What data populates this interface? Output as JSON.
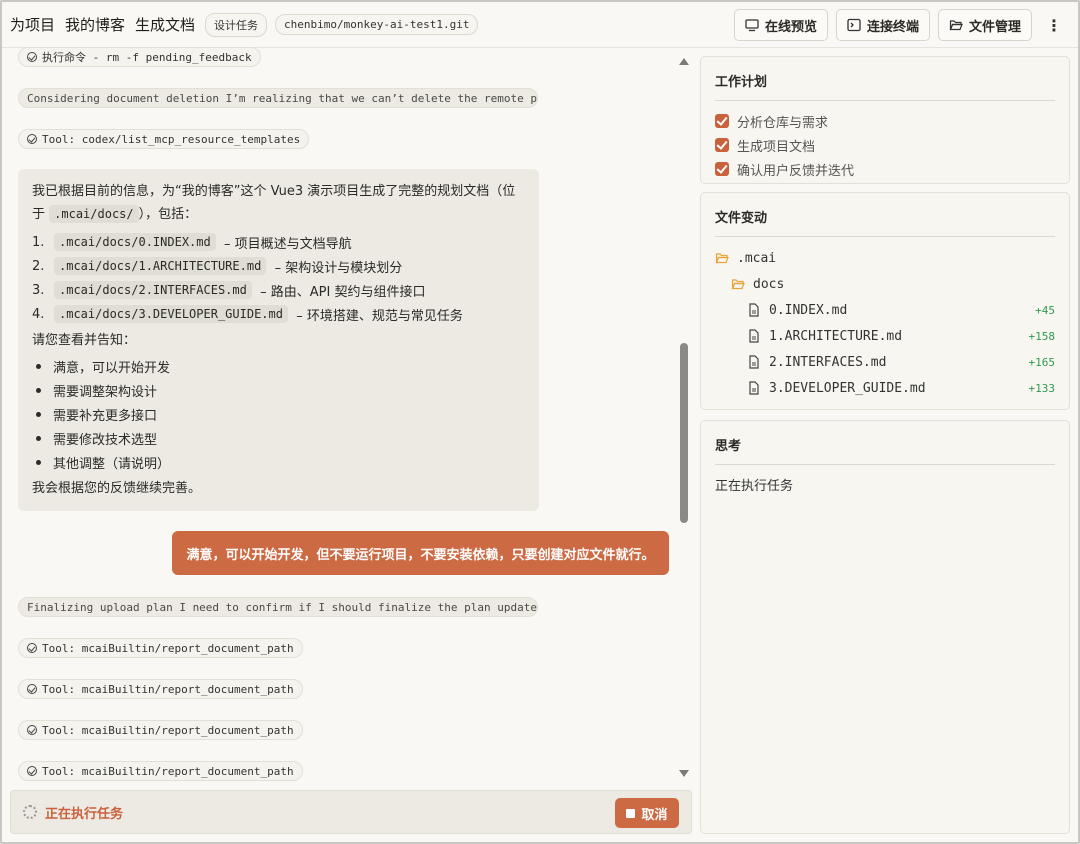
{
  "header": {
    "crumbs": [
      "为项目",
      "我的博客",
      "生成文档"
    ],
    "task_badge": "设计任务",
    "repo": "chenbimo/monkey-ai-test1.git",
    "buttons": {
      "preview": "在线预览",
      "terminal": "连接终端",
      "files": "文件管理"
    },
    "more": "⋮"
  },
  "chat": {
    "top_cmd": "执行命令 - rm -f pending_feedback",
    "reason1": "Considering document deletion I’m realizing that we can’t delete the remote path...",
    "tool_top": "Tool: codex/list_mcp_resource_templates",
    "assistant": {
      "intro_a": "我已根据目前的信息，为“我的博客”这个 Vue3 演示项目生成了完整的规划文档（位",
      "intro_b_pre": "于",
      "intro_b_code": ".mcai/docs/",
      "intro_b_post": "），包括：",
      "docs": [
        {
          "num": "1.",
          "code": ".mcai/docs/0.INDEX.md",
          "desc": "– 项目概述与文档导航"
        },
        {
          "num": "2.",
          "code": ".mcai/docs/1.ARCHITECTURE.md",
          "desc": "– 架构设计与模块划分"
        },
        {
          "num": "3.",
          "code": ".mcai/docs/2.INTERFACES.md",
          "desc": "– 路由、API 契约与组件接口"
        },
        {
          "num": "4.",
          "code": ".mcai/docs/3.DEVELOPER_GUIDE.md",
          "desc": "– 环境搭建、规范与常见任务"
        }
      ],
      "ask": "请您查看并告知：",
      "options": [
        "满意，可以开始开发",
        "需要调整架构设计",
        "需要补充更多接口",
        "需要修改技术选型",
        "其他调整（请说明）"
      ],
      "outro": "我会根据您的反馈继续完善。"
    },
    "user_message": "满意，可以开始开发，但不要运行项目，不要安装依赖，只要创建对应文件就行。",
    "reason2": "Finalizing upload plan I need to confirm if I should finalize the plan update...",
    "tools": [
      "Tool: mcaiBuiltin/report_document_path",
      "Tool: mcaiBuiltin/report_document_path",
      "Tool: mcaiBuiltin/report_document_path",
      "Tool: mcaiBuiltin/report_document_path"
    ]
  },
  "status": {
    "text": "正在执行任务",
    "cancel": "取消"
  },
  "plan": {
    "title": "工作计划",
    "items": [
      "分析仓库与需求",
      "生成项目文档",
      "确认用户反馈并迭代"
    ]
  },
  "changes": {
    "title": "文件变动",
    "folder": ".mcai",
    "subfolder": "docs",
    "files": [
      {
        "name": "0.INDEX.md",
        "delta": "+45"
      },
      {
        "name": "1.ARCHITECTURE.md",
        "delta": "+158"
      },
      {
        "name": "2.INTERFACES.md",
        "delta": "+165"
      },
      {
        "name": "3.DEVELOPER_GUIDE.md",
        "delta": "+133"
      }
    ],
    "accent": "#2f9a50"
  },
  "thinking": {
    "title": "思考",
    "text": "正在执行任务"
  },
  "colors": {
    "accent": "#cc6a43",
    "success": "#2f9a50"
  }
}
